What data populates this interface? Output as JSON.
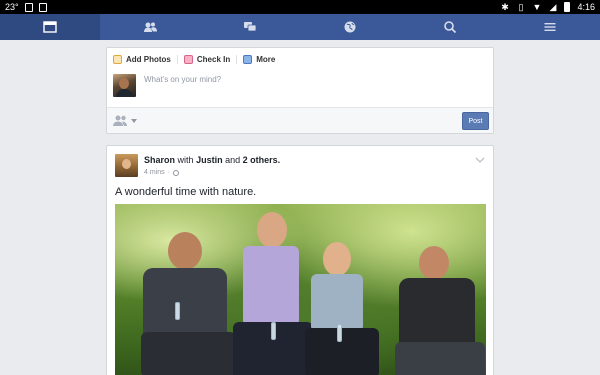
{
  "status_bar": {
    "temperature": "23°",
    "time": "4:16",
    "left_icons": [
      "sim-card-icon",
      "briefcase-icon"
    ],
    "right_icons": [
      "bluetooth-icon",
      "vibrate-icon",
      "wifi-icon",
      "signal-icon",
      "battery-icon"
    ]
  },
  "nav": {
    "tabs": [
      {
        "icon": "news-feed-icon",
        "active": true
      },
      {
        "icon": "friend-requests-icon",
        "active": false
      },
      {
        "icon": "messages-icon",
        "active": false
      },
      {
        "icon": "notifications-globe-icon",
        "active": false
      },
      {
        "icon": "search-icon",
        "active": false
      },
      {
        "icon": "menu-icon",
        "active": false
      }
    ],
    "colors": {
      "bar": "#3b5998",
      "active": "#2f4a81"
    }
  },
  "composer": {
    "add_photos": "Add Photos",
    "check_in": "Check In",
    "more": "More",
    "placeholder": "What's on your mind?",
    "post_label": "Post"
  },
  "story": {
    "author": "Sharon",
    "with_word": "with",
    "tagged": "Justin",
    "and_word": "and",
    "others": "2 others.",
    "time": "4 mins",
    "text": "A wonderful time with nature."
  }
}
